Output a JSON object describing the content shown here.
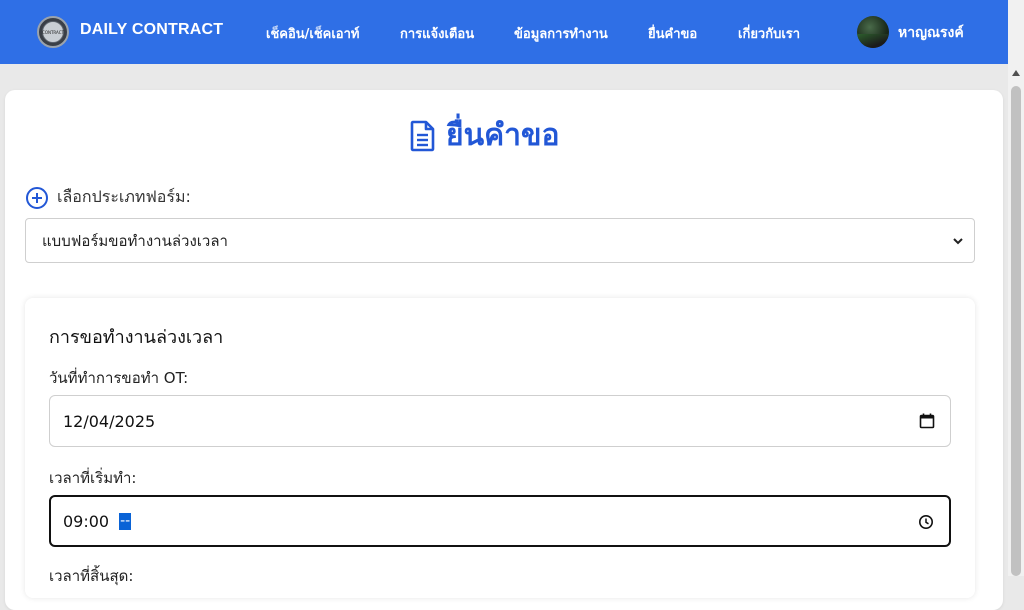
{
  "brand": {
    "name": "DAILY CONTRACT",
    "logo_text": "CONTRACT"
  },
  "nav": {
    "items": [
      {
        "label": "เช็คอิน/เช็คเอาท์"
      },
      {
        "label": "การแจ้งเตือน"
      },
      {
        "label": "ข้อมูลการทำงาน"
      },
      {
        "label": "ยื่นคำขอ"
      },
      {
        "label": "เกี่ยวกับเรา"
      }
    ],
    "user_name": "หาญณรงค์"
  },
  "page": {
    "title": "ยื่นคำขอ",
    "form_type_label": "เลือกประเภทฟอร์ม:",
    "form_type_selected": "แบบฟอร์มขอทำงานล่วงเวลา"
  },
  "ot_form": {
    "section_title": "การขอทำงานล่วงเวลา",
    "date_label": "วันที่ทำการขอทำ OT:",
    "date_value": "12/04/2025",
    "start_label": "เวลาที่เริ่มทำ:",
    "start_value": "09:00",
    "start_ampm_placeholder": "--",
    "end_label": "เวลาที่สิ้นสุด:"
  },
  "colors": {
    "primary": "#2f6fe6",
    "accent": "#2257d6"
  }
}
